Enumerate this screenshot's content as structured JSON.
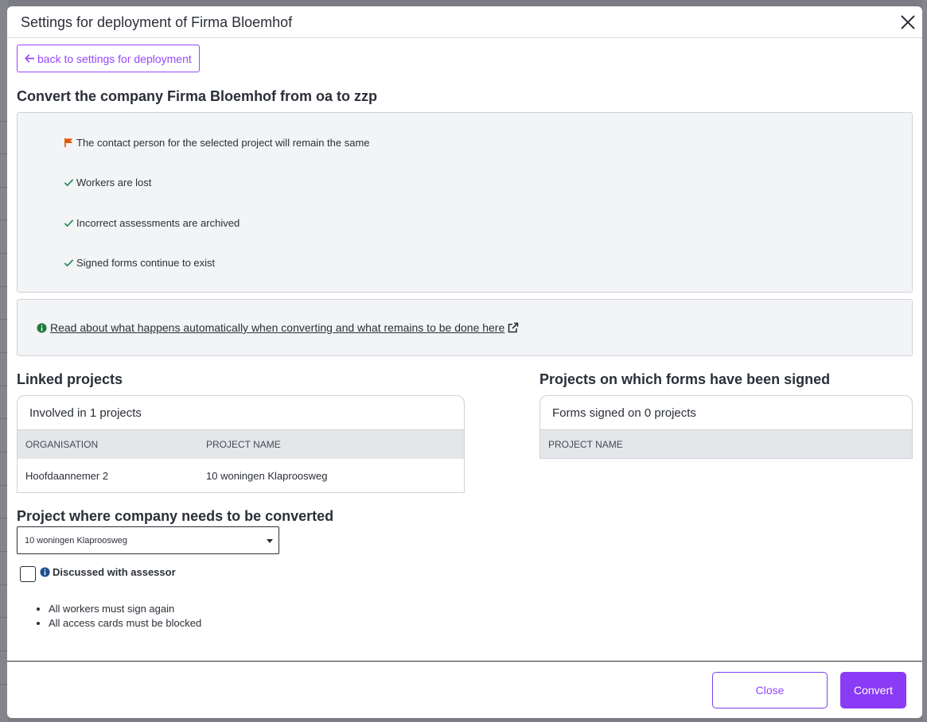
{
  "modal": {
    "title": "Settings for deployment of Firma Bloemhof"
  },
  "back_button": {
    "label": "back to settings for deployment"
  },
  "convert_section": {
    "title": "Convert the company Firma Bloemhof from oa to zzp",
    "items": [
      {
        "icon": "flag-icon",
        "text": "The contact person for the selected project will remain the same"
      },
      {
        "icon": "check-icon",
        "text": "Workers are lost"
      },
      {
        "icon": "check-icon",
        "text": "Incorrect assessments are archived"
      },
      {
        "icon": "check-icon",
        "text": "Signed forms continue to exist"
      }
    ]
  },
  "info_link": {
    "text": "Read about what happens automatically when converting and what remains to be done here"
  },
  "linked_projects": {
    "title": "Linked projects",
    "card_header": "Involved in 1 projects",
    "columns": [
      "ORGANISATION",
      "PROJECT NAME"
    ],
    "rows": [
      [
        "Hoofdaannemer 2",
        "10 woningen Klaproosweg"
      ]
    ]
  },
  "signed_projects": {
    "title": "Projects on which forms have been signed",
    "card_header": "Forms signed on 0 projects",
    "columns": [
      "PROJECT NAME"
    ]
  },
  "convert_project": {
    "title": "Project where company needs to be converted",
    "selected": "10 woningen Klaproosweg",
    "checkbox_label": "Discussed with assessor",
    "notes": [
      "All workers must sign again",
      "All access cards must be blocked"
    ]
  },
  "footer": {
    "close_label": "Close",
    "convert_label": "Convert"
  },
  "colors": {
    "accent": "#9747ff",
    "flag": "#e05a0c",
    "check": "#1f8a4c",
    "info": "#1f7a3c",
    "info_blue": "#1d4f91"
  }
}
